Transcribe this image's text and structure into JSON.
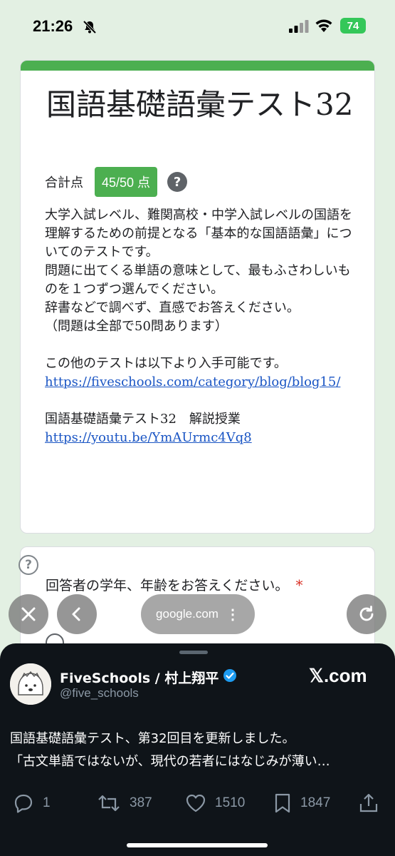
{
  "status_bar": {
    "time": "21:26",
    "battery": "74",
    "icons": [
      "bell-slash-icon",
      "cellular-signal-icon",
      "wifi-icon",
      "battery-charging-icon"
    ]
  },
  "form": {
    "title": "国語基礎語彙テスト32",
    "score_label": "合計点",
    "score_value": "45/50 点",
    "help_symbol": "?",
    "description_lines": [
      "大学入試レベル、難関高校・中学入試レベルの国語を理解するための前提となる「基本的な国語語彙」についてのテストです。",
      "問題に出てくる単語の意味として、最もふさわしいものを１つずつ選んでください。",
      "辞書などで調べず、直感でお答えください。",
      "（問題は全部で50問あります）"
    ],
    "other_tests_text": "この他のテストは以下より入手可能です。",
    "other_tests_link": "https://fiveschools.com/category/blog/blog15/",
    "lecture_text": "国語基礎語彙テスト32　解説授業",
    "lecture_link": "https://youtu.be/YmAUrmc4Vq8",
    "accent_color": "#4caf50"
  },
  "question": {
    "help_symbol": "?",
    "text": "回答者の学年、年齢をお答えください。",
    "required_mark": "*"
  },
  "browser": {
    "url": "google.com",
    "menu_symbol": "⋮",
    "buttons": [
      "close-icon",
      "back-icon",
      "reload-icon"
    ]
  },
  "tweet": {
    "author_name": "FiveSchools / 村上翔平",
    "handle": "@five_schools",
    "source": "𝕏.com",
    "text_lines": [
      "国語基礎語彙テスト、第32回目を更新しました。",
      "「古文単語ではないが、現代の若者にはなじみが薄い…"
    ],
    "replies": "1",
    "retweets": "387",
    "likes": "1510",
    "bookmarks": "1847",
    "background": "#0f1419"
  }
}
